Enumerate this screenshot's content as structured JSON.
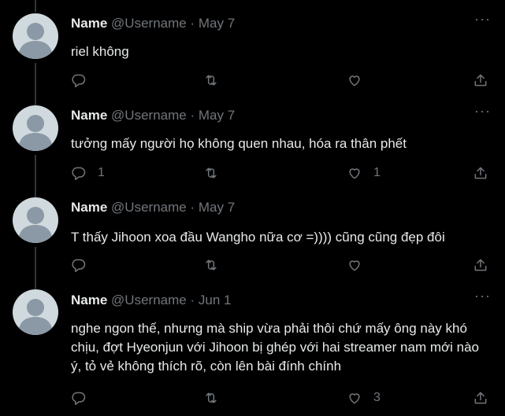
{
  "tweets": [
    {
      "name": "Name",
      "handle": "@Username",
      "date": "May 7",
      "text": "riel không",
      "reply_count": "",
      "like_count": ""
    },
    {
      "name": "Name",
      "handle": "@Username",
      "date": "May 7",
      "text": "tưởng mấy người họ không quen nhau, hóa ra thân phết",
      "reply_count": "1",
      "like_count": "1"
    },
    {
      "name": "Name",
      "handle": "@Username",
      "date": "May 7",
      "text": "T thấy Jihoon xoa đầu Wangho nữa cơ =)))) cũng cũng đẹp đôi",
      "reply_count": "",
      "like_count": ""
    },
    {
      "name": "Name",
      "handle": "@Username",
      "date": "Jun 1",
      "text": "nghe ngon thế, nhưng mà ship vừa phải thôi chứ mấy ông này khó chịu, đợt Hyeonjun với Jihoon bị ghép với hai streamer nam mới nào ý, tỏ vẻ không thích rõ, còn lên bài đính chính",
      "reply_count": "",
      "like_count": "3"
    }
  ],
  "separator": "·",
  "more_label": "···",
  "icons": [
    "reply-icon",
    "retweet-icon",
    "like-icon",
    "share-icon",
    "more-icon",
    "avatar-placeholder"
  ],
  "colors": {
    "background": "#000000",
    "text": "#e7e9ea",
    "muted": "#71767b",
    "thread_line": "#333639",
    "avatar": "#cfd9de"
  }
}
